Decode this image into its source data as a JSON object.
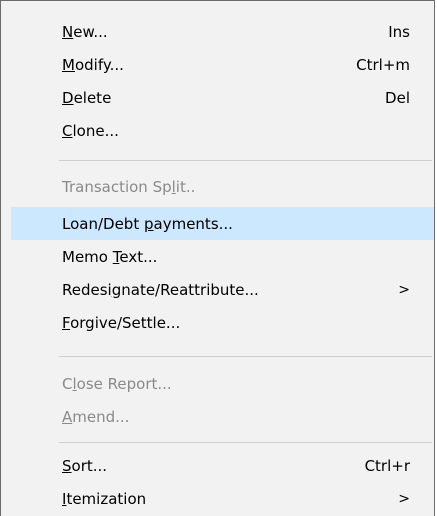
{
  "menu": {
    "items": [
      {
        "pre": "",
        "acc": "N",
        "post": "ew...",
        "shortcut": "Ins",
        "submenu": false,
        "disabled": false,
        "highlighted": false
      },
      {
        "pre": "",
        "acc": "M",
        "post": "odify...",
        "shortcut": "Ctrl+m",
        "submenu": false,
        "disabled": false,
        "highlighted": false
      },
      {
        "pre": "",
        "acc": "D",
        "post": "elete",
        "shortcut": "Del",
        "submenu": false,
        "disabled": false,
        "highlighted": false
      },
      {
        "pre": "",
        "acc": "C",
        "post": "lone...",
        "shortcut": "",
        "submenu": false,
        "disabled": false,
        "highlighted": false
      },
      {
        "pre": "Transaction Sp",
        "acc": "l",
        "post": "it..",
        "shortcut": "",
        "submenu": false,
        "disabled": true,
        "highlighted": false
      },
      {
        "pre": "Loan/Debt ",
        "acc": "p",
        "post": "ayments...",
        "shortcut": "",
        "submenu": false,
        "disabled": false,
        "highlighted": true
      },
      {
        "pre": "Memo ",
        "acc": "T",
        "post": "ext...",
        "shortcut": "",
        "submenu": false,
        "disabled": false,
        "highlighted": false
      },
      {
        "pre": "Redesi",
        "acc": "g",
        "post": "nate/Reattribute...",
        "shortcut": "",
        "submenu": true,
        "disabled": false,
        "highlighted": false
      },
      {
        "pre": "",
        "acc": "F",
        "post": "orgive/Settle...",
        "shortcut": "",
        "submenu": false,
        "disabled": false,
        "highlighted": false
      },
      {
        "pre": "C",
        "acc": "l",
        "post": "ose Report...",
        "shortcut": "",
        "submenu": false,
        "disabled": true,
        "highlighted": false
      },
      {
        "pre": "",
        "acc": "A",
        "post": "mend...",
        "shortcut": "",
        "submenu": false,
        "disabled": true,
        "highlighted": false
      },
      {
        "pre": "",
        "acc": "S",
        "post": "ort...",
        "shortcut": "Ctrl+r",
        "submenu": false,
        "disabled": false,
        "highlighted": false
      },
      {
        "pre": "",
        "acc": "I",
        "post": "temization",
        "shortcut": "",
        "submenu": true,
        "disabled": false,
        "highlighted": false
      }
    ],
    "submenu_glyph": ">",
    "colors": {
      "highlight": "#cce8ff",
      "disabled_text": "#8a8a8a",
      "background": "#f2f2f2"
    }
  }
}
